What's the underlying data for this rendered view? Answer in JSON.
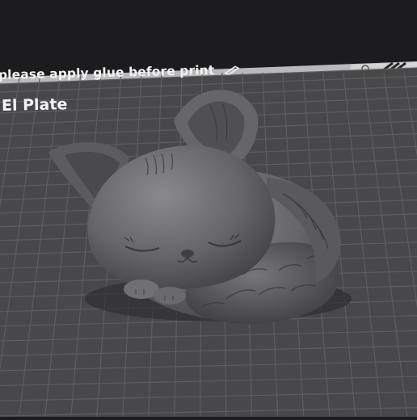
{
  "viewport": {
    "plate_notice": "please apply glue before print",
    "plate_name": "El Plate",
    "model_name": "sleeping-fox-model"
  },
  "icons": {
    "edit": "pencil-icon",
    "corner_logo": "printer-brand-logo"
  },
  "colors": {
    "background": "#1c1c1e",
    "plate": "#4a4a4d",
    "grid": "#5d5d61",
    "model": "#6a6a6c",
    "text": "#f2f2f2"
  }
}
